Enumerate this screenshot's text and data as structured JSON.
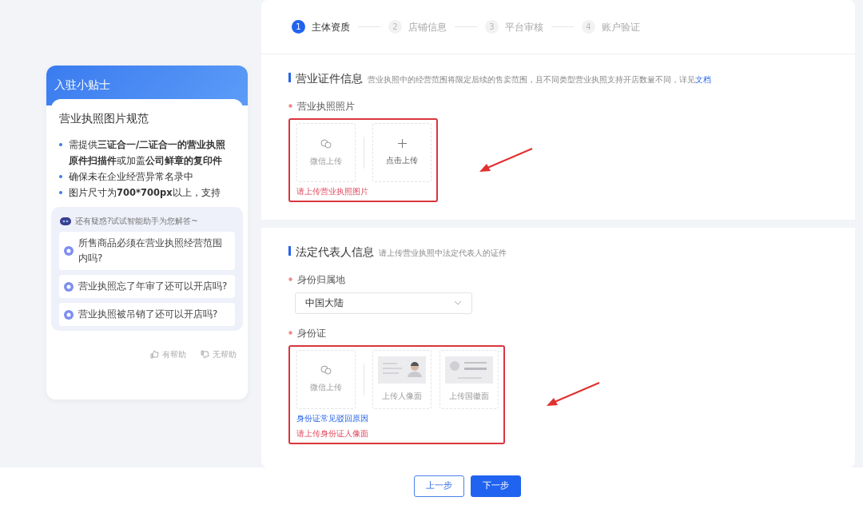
{
  "tips": {
    "title": "入驻小贴士",
    "heading": "营业执照图片规范",
    "bullets": [
      "需提供**三证合一/二证合一的营业执照原件扫描件**或加盖**公司鲜章的复印件**",
      "确保未在企业经营异常名录中",
      "图片尺寸为**700*700px**以上，支持"
    ]
  },
  "assistant": {
    "prompt": "还有疑惑?试试智能助手为您解答~",
    "questions": [
      "所售商品必须在营业执照经营范围内吗?",
      "营业执照忘了年审了还可以开店吗?",
      "营业执照被吊销了还可以开店吗?"
    ]
  },
  "feedback": [
    {
      "kind": "up",
      "label": "有帮助"
    },
    {
      "kind": "down",
      "label": "无帮助"
    }
  ],
  "steps": [
    {
      "number": "1",
      "label": "主体资质",
      "selected": true
    },
    {
      "number": "2",
      "label": "店铺信息",
      "selected": false
    },
    {
      "number": "3",
      "label": "平台审核",
      "selected": false
    },
    {
      "number": "4",
      "label": "账户验证",
      "selected": false
    }
  ],
  "sections": [
    {
      "title": "营业证件信息",
      "description": "营业执照中的经营范围将限定后续的售卖范围，且不同类型营业执照支持开店数量不同，详见",
      "link": "文档",
      "fields": [
        {
          "kind": "upload",
          "label": "营业执照照片",
          "required": true,
          "highlighted": true,
          "tiles": [
            {
              "kind": "wechat",
              "label": "微信上传"
            },
            {
              "kind": "add",
              "label": "点击上传"
            }
          ],
          "error": "请上传营业执照图片"
        }
      ]
    },
    {
      "title": "法定代表人信息",
      "description": "请上传营业执照中法定代表人的证件",
      "fields": [
        {
          "kind": "select",
          "label": "身份归属地",
          "required": true,
          "value": "中国大陆"
        },
        {
          "kind": "upload",
          "label": "身份证",
          "required": true,
          "highlighted": true,
          "tiles": [
            {
              "kind": "wechat",
              "label": "微信上传"
            },
            {
              "kind": "portrait",
              "label": "上传人像面"
            },
            {
              "kind": "emblem",
              "label": "上传国徽面"
            }
          ],
          "help": "身份证常见驳回原因",
          "error": "请上传身份证人像面"
        }
      ]
    }
  ],
  "buttons": [
    {
      "kind": "secondary",
      "label": "上一步"
    },
    {
      "kind": "primary",
      "label": "下一步"
    }
  ]
}
